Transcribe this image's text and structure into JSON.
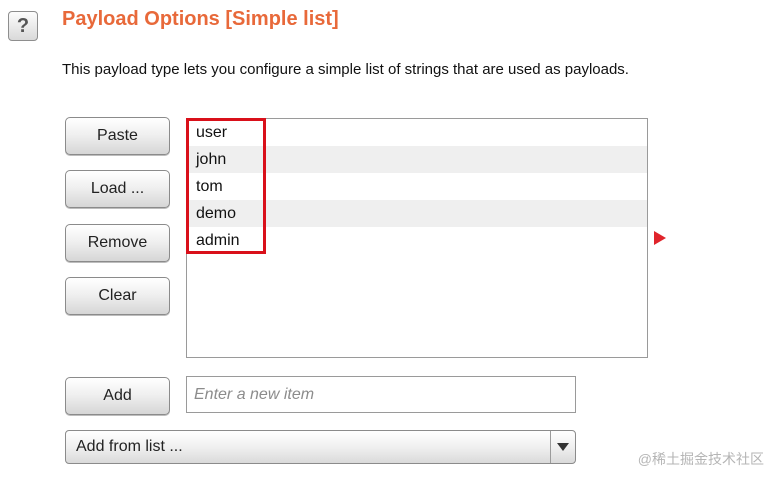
{
  "header": {
    "help_glyph": "?",
    "title": "Payload Options [Simple list]",
    "description": "This payload type lets you configure a simple list of strings that are used as payloads."
  },
  "buttons": {
    "paste": "Paste",
    "load": "Load ...",
    "remove": "Remove",
    "clear": "Clear",
    "add": "Add"
  },
  "list": {
    "items": [
      "user",
      "john",
      "tom",
      "demo",
      "admin"
    ]
  },
  "new_item": {
    "value": "",
    "placeholder": "Enter a new item"
  },
  "add_from_list": {
    "selected": "Add from list ..."
  },
  "watermark": "@稀土掘金技术社区",
  "colors": {
    "title": "#e8693a",
    "highlight": "#d9101a",
    "marker": "#e0242b",
    "row_alt": "#efefef"
  },
  "icons": {
    "help": "help-icon",
    "select_arrow": "chevron-down-icon",
    "marker": "play-triangle-icon"
  }
}
